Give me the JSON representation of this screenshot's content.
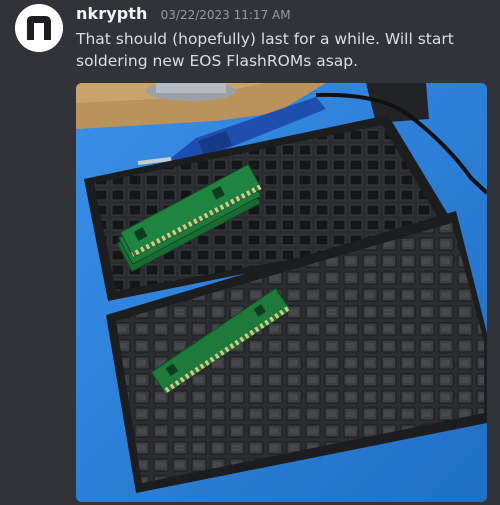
{
  "message": {
    "author": "nkrypth",
    "timestamp": "03/22/2023 11:17 AM",
    "avatar_letter": "n",
    "avatar_colors": {
      "bg": "#ffffff",
      "fg": "#1e1f22"
    },
    "text": "That should (hopefully) last for a while. Will start soldering new EOS FlashROMs asap."
  },
  "attachment": {
    "kind": "photo",
    "subject_icon": "photo-icon"
  },
  "colors": {
    "background": "#313338",
    "username": "#f2f3f5",
    "timestamp": "#949ba4",
    "text": "#dbdee1"
  }
}
